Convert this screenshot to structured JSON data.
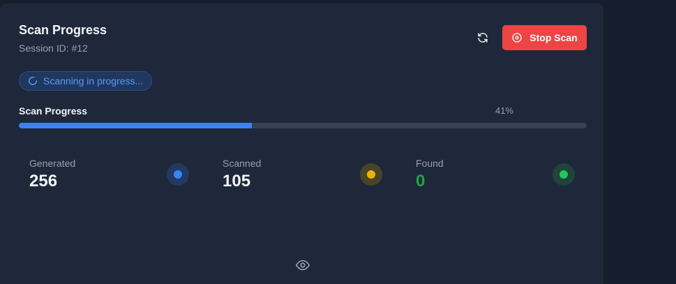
{
  "header": {
    "title": "Scan Progress",
    "session": "Session ID: #12",
    "stop_label": "Stop Scan"
  },
  "status": {
    "text": "Scanning in progress..."
  },
  "progress": {
    "label": "Scan Progress",
    "percent_text": "41%",
    "value": 0.41
  },
  "stats": [
    {
      "label": "Generated",
      "value": "256",
      "color": "#3b82f6",
      "value_color": "#f3f5f9"
    },
    {
      "label": "Scanned",
      "value": "105",
      "color": "#eab308",
      "value_color": "#f3f5f9"
    },
    {
      "label": "Found",
      "value": "0",
      "color": "#22c55e",
      "value_color": "#22a04a"
    }
  ],
  "icons": {
    "refresh": "refresh-icon",
    "stop": "stop-circle-icon",
    "spinner": "spinner-icon",
    "eye": "eye-icon"
  }
}
